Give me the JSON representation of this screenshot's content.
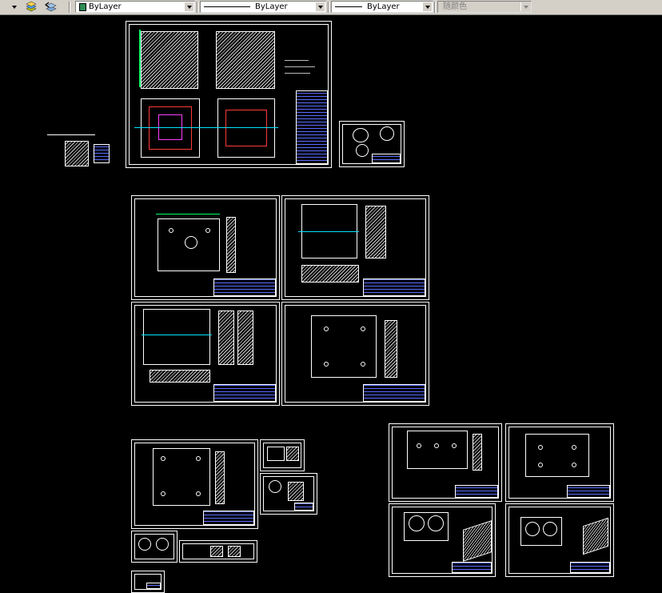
{
  "toolbar": {
    "layer_dropdown": "",
    "color_combo": {
      "value": "ByLayer",
      "swatch_color": "#2e8b57"
    },
    "linetype_combo": {
      "value": "ByLayer"
    },
    "lineweight_combo": {
      "value": "ByLayer"
    },
    "plotstyle_combo": {
      "value": "随颜色"
    },
    "icons": [
      "layer-states-icon",
      "layer-previous-icon"
    ]
  },
  "canvas": {
    "background": "#000000",
    "sheet_line_color": "#ffffff",
    "dimension_color": "#00ff66",
    "centerline_color": "#00e5ff",
    "hatch_color": "#cfcfcf",
    "title_block_color": "#5a6cff"
  }
}
